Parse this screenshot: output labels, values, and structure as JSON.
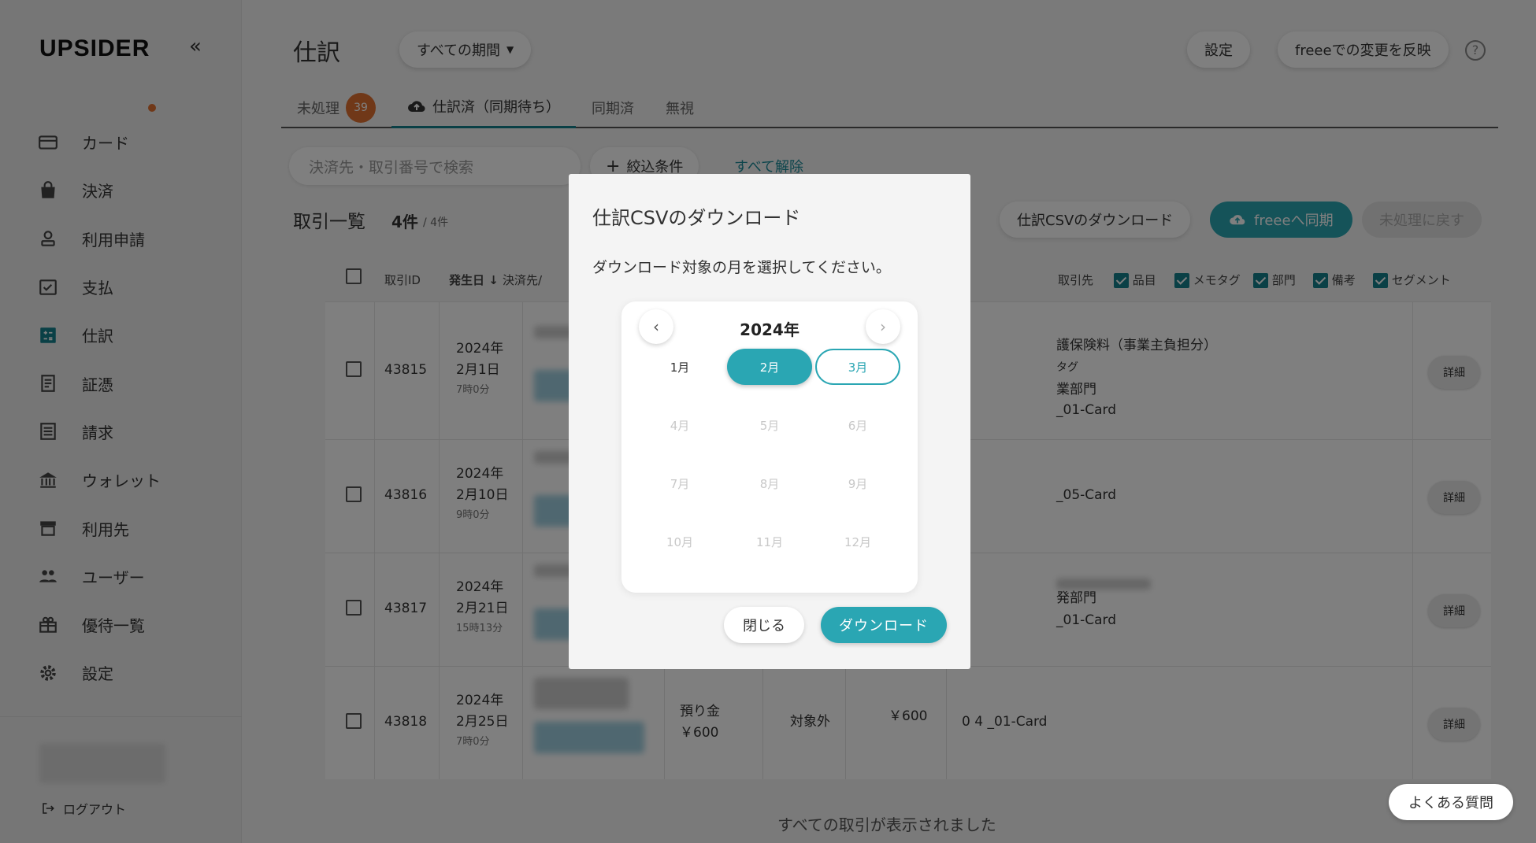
{
  "brand": {
    "logo": "UPSIDER",
    "collapse": "«"
  },
  "sidebar": {
    "items": [
      {
        "label": "カード",
        "icon": "card-icon"
      },
      {
        "label": "決済",
        "icon": "bag-icon"
      },
      {
        "label": "利用申請",
        "icon": "person-stamp-icon"
      },
      {
        "label": "支払",
        "icon": "payment-icon"
      },
      {
        "label": "仕訳",
        "icon": "journal-icon"
      },
      {
        "label": "証憑",
        "icon": "receipt-icon"
      },
      {
        "label": "請求",
        "icon": "invoice-icon"
      },
      {
        "label": "ウォレット",
        "icon": "bank-icon"
      },
      {
        "label": "利用先",
        "icon": "store-icon"
      },
      {
        "label": "ユーザー",
        "icon": "users-icon"
      },
      {
        "label": "優待一覧",
        "icon": "gift-icon"
      },
      {
        "label": "設定",
        "icon": "gear-icon"
      }
    ],
    "logout": "ログアウト"
  },
  "header": {
    "title": "仕訳",
    "period": "すべての期間",
    "settings": "設定",
    "reflect": "freeeでの変更を反映",
    "help": "?"
  },
  "tabs": [
    {
      "label": "未処理",
      "badge": "39"
    },
    {
      "label": "仕訳済（同期待ち）"
    },
    {
      "label": "同期済"
    },
    {
      "label": "無視"
    }
  ],
  "toolbar": {
    "search_placeholder": "決済先・取引番号で検索",
    "filter": "絞込条件",
    "clear": "すべて解除",
    "list_title": "取引一覧",
    "count": "4件",
    "count_total": "/ 4件",
    "csv": "仕訳CSVのダウンロード",
    "sync": "freeeへ同期",
    "revert": "未処理に戻す"
  },
  "table": {
    "headers": [
      "取引ID",
      "発生日",
      "決済先/",
      "取引先",
      "品目",
      "メモタグ",
      "部門",
      "備考",
      "セグメント"
    ],
    "rows": [
      {
        "id": "43815",
        "date1": "2024年",
        "date2": "2月1日",
        "time": "7時0分",
        "lines": [
          "護保険料（事業主負担分）",
          "タグ",
          "業部門",
          "_01-Card"
        ]
      },
      {
        "id": "43816",
        "date1": "2024年",
        "date2": "2月10日",
        "time": "9時0分",
        "lines": [
          "_05-Card"
        ]
      },
      {
        "id": "43817",
        "date1": "2024年",
        "date2": "2月21日",
        "time": "15時13分",
        "lines": [
          "発部門",
          "_01-Card"
        ]
      },
      {
        "id": "43818",
        "date1": "2024年",
        "date2": "2月25日",
        "time": "7時0分",
        "account": "預り金",
        "amount": "￥600",
        "tax": "対象外",
        "amount2": "￥600",
        "lines": [
          "0 4 _01-Card"
        ]
      }
    ],
    "detail": "詳細"
  },
  "footer": {
    "message": "すべての取引が表示されました",
    "faq": "よくある質問"
  },
  "modal": {
    "title": "仕訳CSVのダウンロード",
    "message": "ダウンロード対象の月を選択してください。",
    "year": "2024年",
    "prev": "‹",
    "next": "›",
    "months": [
      "1月",
      "2月",
      "3月",
      "4月",
      "5月",
      "6月",
      "7月",
      "8月",
      "9月",
      "10月",
      "11月",
      "12月"
    ],
    "selected_month": "2月",
    "close": "閉じる",
    "download": "ダウンロード"
  },
  "colors": {
    "accent": "#2aa6b3",
    "badge": "#e07030",
    "overlay": "rgba(0,0,0,0.5)"
  }
}
